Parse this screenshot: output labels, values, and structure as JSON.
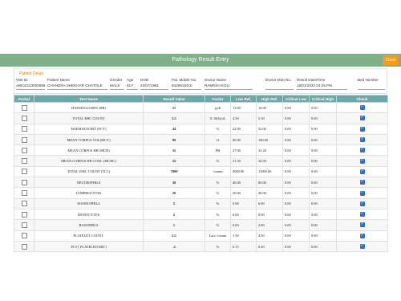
{
  "header": {
    "title": "Pathology Result Entry",
    "close_label": "Close",
    "color": "#80b08a",
    "close_color": "#f39c1f"
  },
  "patient": {
    "section_label": "Patient Detail",
    "fields": [
      {
        "label": "Visit ID",
        "value": "AWO2223000686"
      },
      {
        "label": "Patient Name",
        "value": "CHANDRA SHEKHAR GHATOLE"
      },
      {
        "label": "Gender",
        "value": "MALE"
      },
      {
        "label": "Age",
        "value": "61Y"
      },
      {
        "label": "DOB",
        "value": "22/07/1961"
      },
      {
        "label": "Pat. Mobile No.",
        "value": "9425819410"
      },
      {
        "label": "Doctor Name",
        "value": "RAMESH KOLI"
      },
      {
        "label": "Doctor Mob No.",
        "value": ""
      },
      {
        "label": "Result Date/Time",
        "value": "18/01/2023 04:25 PM"
      },
      {
        "label": "Bed Number",
        "value": ""
      }
    ]
  },
  "table": {
    "headers": [
      "Partial",
      "Test Name",
      "Result Value",
      "Factor",
      "Low Ref.",
      "High Ref.",
      "Critical Low",
      "Critical High",
      "Check"
    ],
    "rows": [
      {
        "name": "HAEMOGLOBIN (HB)",
        "result": "11",
        "flag": "red",
        "factor": "g/dl",
        "low": "13.00",
        "high": "16.00",
        "clow": "0.00",
        "chigh": "0.00"
      },
      {
        "name": "TOTAL RBC COUNT",
        "result": "3.5",
        "flag": "red",
        "factor": "X 10(6)/uL",
        "low": "4.50",
        "high": "5.50",
        "clow": "0.00",
        "chigh": "0.00"
      },
      {
        "name": "HAEMATOCRIT (PCV)",
        "result": "44",
        "flag": "red",
        "factor": "%",
        "low": "42.00",
        "high": "52.00",
        "clow": "0.00",
        "chigh": "0.00"
      },
      {
        "name": "MEAN CORPUS VOL(MCV)",
        "result": "99",
        "flag": "red",
        "factor": "f1",
        "low": "80.00",
        "high": "100.00",
        "clow": "0.00",
        "chigh": "0.00"
      },
      {
        "name": "MEAN CORPUS HB (MCH)",
        "result": "35",
        "flag": "red",
        "factor": "PB",
        "low": "27.00",
        "high": "33.20",
        "clow": "0.00",
        "chigh": "0.00"
      },
      {
        "name": "MEAN CORPUS HB CONC (MCHC)",
        "result": "32",
        "flag": "red",
        "factor": "%",
        "low": "31.50",
        "high": "34.50",
        "clow": "0.00",
        "chigh": "0.00"
      },
      {
        "name": "TOTAL WBC COUNT (TLC)",
        "result": "7000",
        "flag": "",
        "factor": "/cumm",
        "low": "4000.00",
        "high": "11000.00",
        "clow": "0.00",
        "chigh": "0.00"
      },
      {
        "name": "NEUTROPHILS",
        "result": "30",
        "flag": "red",
        "factor": "%",
        "low": "40.00",
        "high": "80.00",
        "clow": "0.00",
        "chigh": "0.00"
      },
      {
        "name": "LYMPHOCYTES",
        "result": "20",
        "flag": "red",
        "factor": "%",
        "low": "20.00",
        "high": "40.00",
        "clow": "0.00",
        "chigh": "0.00"
      },
      {
        "name": "EOSINOPHILS",
        "result": "5",
        "flag": "red",
        "factor": "%",
        "low": "0.00",
        "high": "6.00",
        "clow": "0.00",
        "chigh": "0.00"
      },
      {
        "name": "MONOCYTES",
        "result": "5",
        "flag": "red",
        "factor": "%",
        "low": "0.00",
        "high": "8.00",
        "clow": "0.00",
        "chigh": "0.00"
      },
      {
        "name": "BASOPHILS",
        "result": "1",
        "flag": "red",
        "factor": "%",
        "low": "0.00",
        "high": "2.00",
        "clow": "0.00",
        "chigh": "0.00"
      },
      {
        "name": "PLATELET COUNT.",
        "result": "2.5",
        "flag": "red",
        "factor": "Lacs /cumm",
        "low": "1.50",
        "high": "4.50",
        "clow": "0.00",
        "chigh": "0.00"
      },
      {
        "name": "PCT ( PLATELETCRIT)",
        "result": ".2",
        "flag": "red",
        "factor": "%",
        "low": "0.15",
        "high": "0.40",
        "clow": "0.00",
        "chigh": "0.00"
      }
    ]
  }
}
